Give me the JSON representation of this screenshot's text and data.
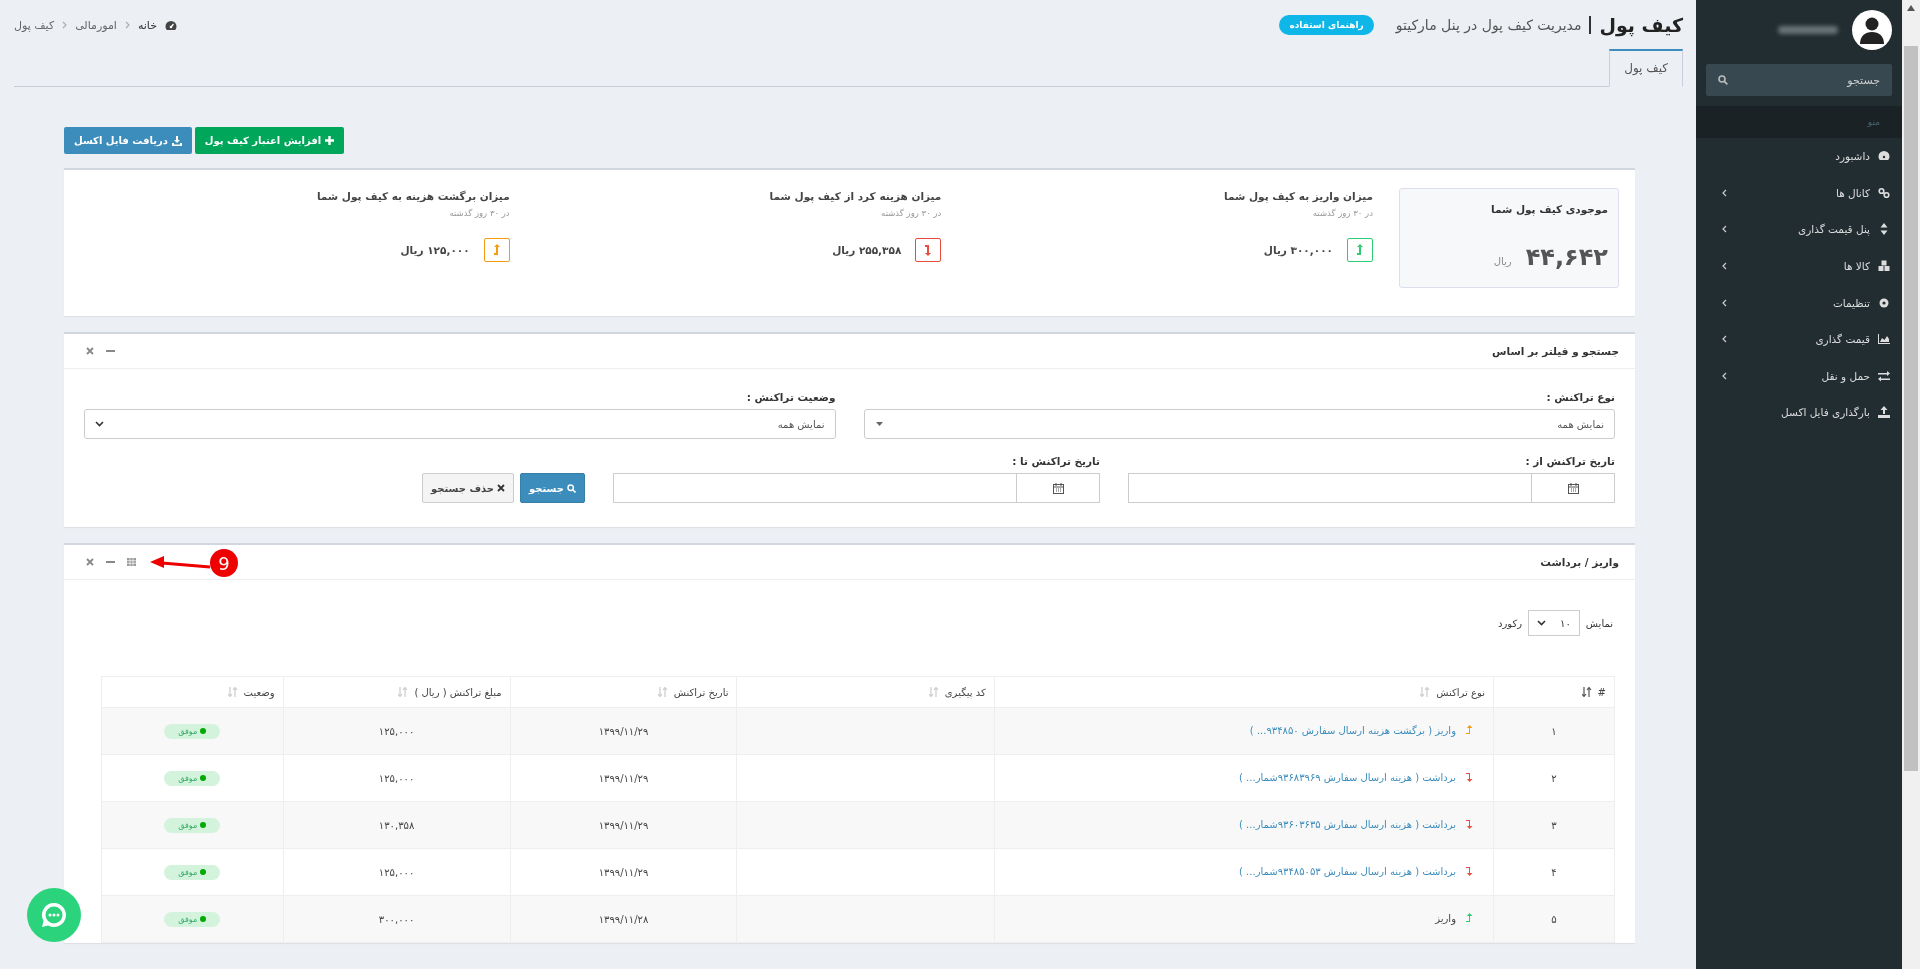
{
  "header": {
    "title": "کیف پول",
    "subtitle": "مدیریت کیف پول در پنل مارکیتو",
    "help_button": "راهنمای استفاده",
    "breadcrumbs": [
      "خانه",
      "امورمالی",
      "کیف پول"
    ]
  },
  "tabs": [
    {
      "label": "کیف پول",
      "selected": true
    }
  ],
  "actions": [
    {
      "label": "افزایش اعتبار کیف پول",
      "kind": "add"
    },
    {
      "label": "دریافت فایل اکسل",
      "kind": "download"
    }
  ],
  "balance": {
    "label": "موجودی کیف پول شما",
    "amount": "۴۴,۶۴۲",
    "unit": "ریال"
  },
  "stats": [
    {
      "title": "میزان واریز به کیف پول شما",
      "period": "در ۳۰ روز گذشته",
      "amount": "۳۰۰,۰۰۰ ریال",
      "kind": "deposit"
    },
    {
      "title": "میزان هزینه کرد از کیف پول شما",
      "period": "در ۳۰ روز گذشته",
      "amount": "۲۵۵,۳۵۸ ریال",
      "kind": "withdraw"
    },
    {
      "title": "میزان برگشت هزینه به کیف پول شما",
      "period": "در ۳۰ روز گذشته",
      "amount": "۱۲۵,۰۰۰ ریال",
      "kind": "refund"
    }
  ],
  "filter": {
    "title": "جستجو و فیلتر بر اساس",
    "selects": [
      {
        "label": "نوع تراکنش :",
        "value": "نمایش همه"
      },
      {
        "label": "وضعیت تراکنش :",
        "value": "نمایش همه"
      }
    ],
    "dates": [
      {
        "label": "تاریخ تراکنش از :"
      },
      {
        "label": "تاریخ تراکنش تا :"
      }
    ],
    "buttons": [
      {
        "label": "جستجو",
        "kind": "search"
      },
      {
        "label": "حذف جستجو",
        "kind": "clear"
      }
    ]
  },
  "transactions": {
    "title": "واریز / برداشت",
    "annotation": "9",
    "page_size": {
      "before": "نمایش",
      "value": "۱۰",
      "after": "رکورد"
    },
    "columns": [
      "#",
      "نوع تراکنش",
      "کد پیگیری",
      "تاریخ تراکنش",
      "مبلغ تراکنش ( ریال )",
      "وضعیت"
    ],
    "rows": [
      {
        "number": "۱",
        "kind": "refund",
        "type": "واریز ( برگشت هزینه ارسال سفارش ۹۳۴۸۵۰... )",
        "link": true,
        "date": "۱۳۹۹/۱۱/۲۹",
        "amount": "۱۲۵,۰۰۰",
        "status": "موفق"
      },
      {
        "number": "۲",
        "kind": "withdraw",
        "type": "برداشت ( هزینه ارسال سفارش ۹۳۶۸۳۹۶۹شمار... )",
        "link": true,
        "date": "۱۳۹۹/۱۱/۲۹",
        "amount": "۱۲۵,۰۰۰",
        "status": "موفق"
      },
      {
        "number": "۳",
        "kind": "withdraw",
        "type": "برداشت ( هزینه ارسال سفارش ۹۳۶۰۳۶۳۵شمار... )",
        "link": true,
        "date": "۱۳۹۹/۱۱/۲۹",
        "amount": "۱۳۰,۳۵۸",
        "status": "موفق"
      },
      {
        "number": "۴",
        "kind": "withdraw",
        "type": "برداشت ( هزینه ارسال سفارش ۹۳۴۸۵۰۵۳شمار... )",
        "link": true,
        "date": "۱۳۹۹/۱۱/۲۹",
        "amount": "۱۲۵,۰۰۰",
        "status": "موفق"
      },
      {
        "number": "۵",
        "kind": "deposit",
        "type": "واریز",
        "link": false,
        "date": "۱۳۹۹/۱۱/۲۸",
        "amount": "۳۰۰,۰۰۰",
        "status": "موفق"
      }
    ]
  },
  "sidebar": {
    "search": {
      "placeholder": "جستجو"
    },
    "menu_label": "منو",
    "items": [
      {
        "label": "داشبورد",
        "expandable": false
      },
      {
        "label": "کانال ها",
        "expandable": true
      },
      {
        "label": "پنل قیمت گذاری",
        "expandable": true
      },
      {
        "label": "کالا ها",
        "expandable": true
      },
      {
        "label": "تنظیمات",
        "expandable": true
      },
      {
        "label": "قیمت گذاری",
        "expandable": true
      },
      {
        "label": "حمل و نقل",
        "expandable": true
      },
      {
        "label": "بارگذاری فایل اکسل",
        "expandable": false
      }
    ]
  }
}
